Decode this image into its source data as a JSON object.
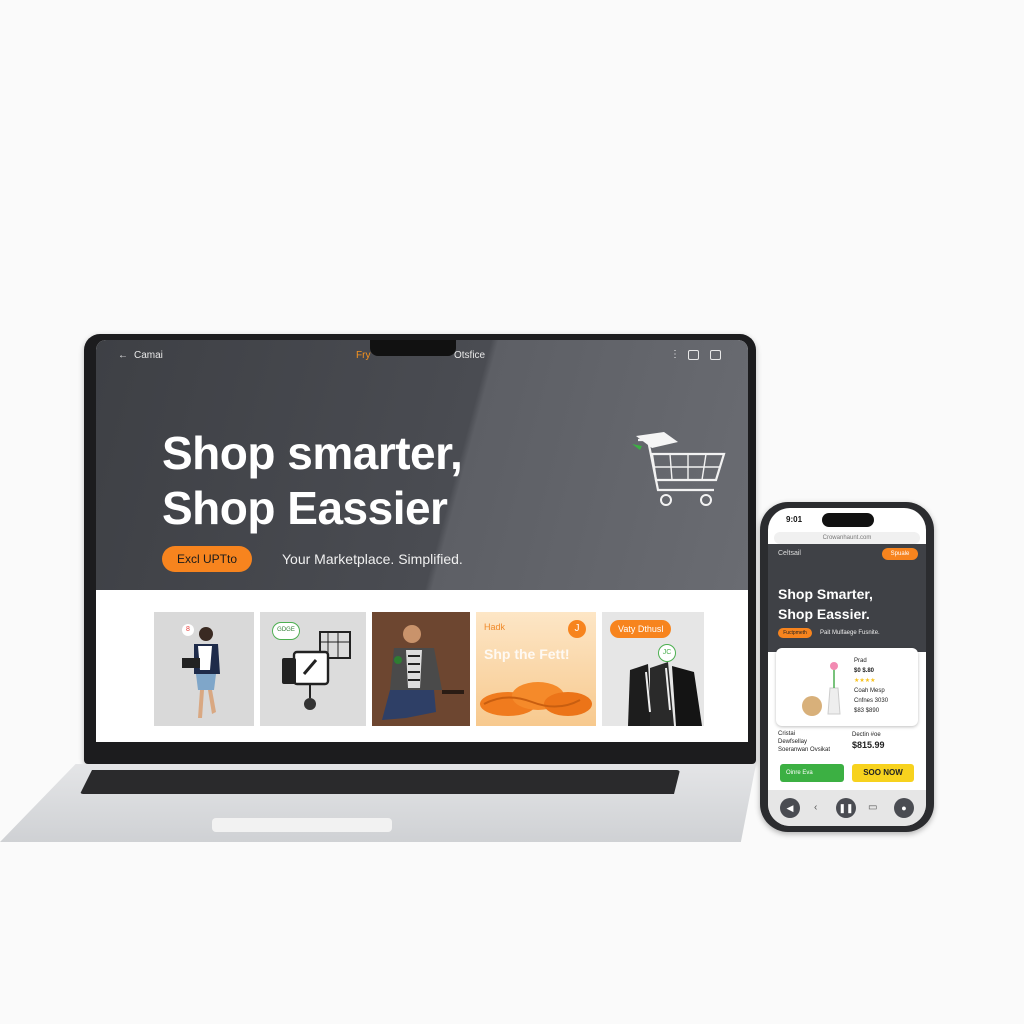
{
  "laptop": {
    "topbar": {
      "back_icon": "arrow-left-icon",
      "brand": "Camai",
      "pay": "Fry",
      "store": "Otsfice",
      "more_icon": "kebab-icon",
      "icons": [
        "gallery-icon",
        "share-icon"
      ]
    },
    "hero": {
      "headline_line1": "Shop smarter,",
      "headline_line2": "Shop Eassier",
      "cta_label": "Excl UPTto",
      "tagline": "Your Marketplace. Simplified.",
      "illustration": "shopping-cart-icon"
    },
    "products": [
      {
        "name": "woman-with-laptop",
        "badge": "8"
      },
      {
        "name": "gadgets",
        "badge": "GDGE"
      },
      {
        "name": "man-with-shirt",
        "badge": ""
      },
      {
        "name": "orange-rope",
        "label": "Hadk",
        "title": "Shp the Fett!",
        "badge": "J"
      },
      {
        "name": "jackets",
        "tag": "Vaty Dthusl",
        "badge": "JC"
      }
    ],
    "colors": {
      "accent": "#f7841e",
      "hero_bg": "#45474c"
    }
  },
  "phone": {
    "status_time": "9:01",
    "address": "Crowanhaunt.com",
    "brand": "Celtsail",
    "header_button": "Spuale",
    "headline_line1": "Shop Smarter,",
    "headline_line2": "Shop Eassier.",
    "cta_label": "Fuctpmeth",
    "tagline": "Pait Mulfaege Fusnite.",
    "card": {
      "title": "Prad",
      "price": "$0 $.80",
      "stars": "★★★★",
      "desc1": "Coah Mesp",
      "desc2": "Cnfnes 3030",
      "desc3": "$83 $890"
    },
    "footer_left": [
      "Cristai",
      "Dewfsellay",
      "Soeranwan Ovsikat"
    ],
    "footer_right_label": "Dectin #oe",
    "footer_price": "$815.99",
    "green_button": "Oinre Eva",
    "yellow_button": "SOO NOW",
    "nav": [
      "back-icon",
      "chevron-left-icon",
      "pause-icon",
      "bookmark-icon",
      "profile-icon"
    ],
    "colors": {
      "green": "#3cb043",
      "yellow": "#f7d21e"
    }
  }
}
